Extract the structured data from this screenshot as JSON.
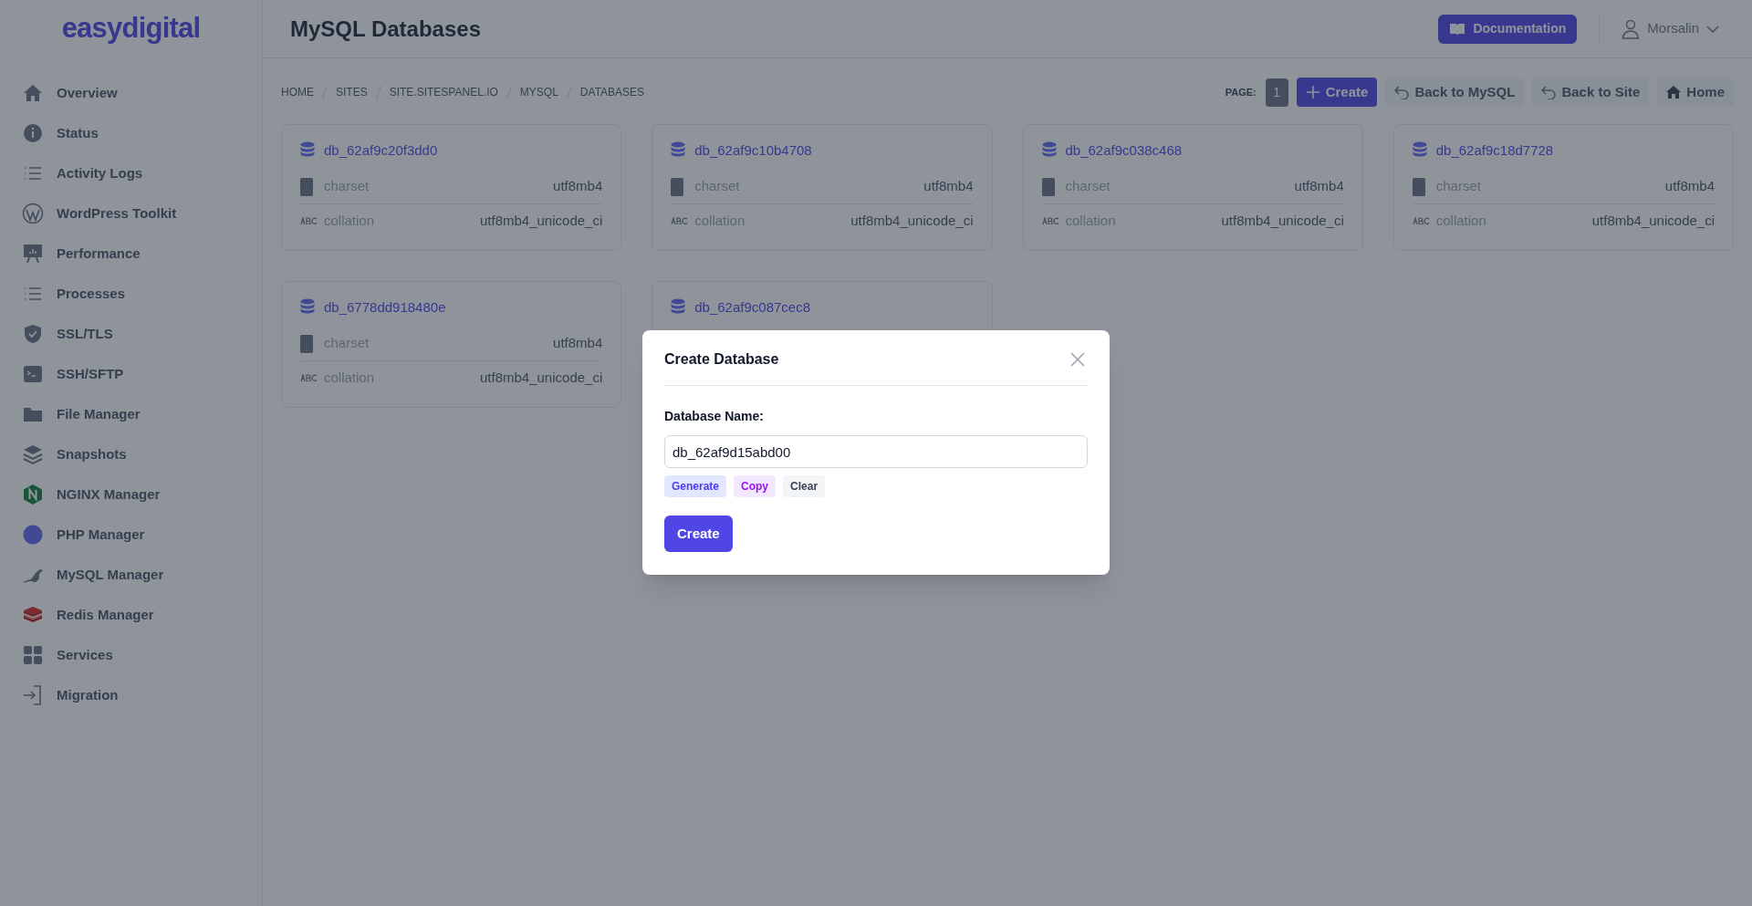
{
  "logo": "easydigital",
  "sidebar": {
    "items": [
      {
        "label": "Overview"
      },
      {
        "label": "Status"
      },
      {
        "label": "Activity Logs"
      },
      {
        "label": "WordPress Toolkit"
      },
      {
        "label": "Performance"
      },
      {
        "label": "Processes"
      },
      {
        "label": "SSL/TLS"
      },
      {
        "label": "SSH/SFTP"
      },
      {
        "label": "File Manager"
      },
      {
        "label": "Snapshots"
      },
      {
        "label": "NGINX Manager"
      },
      {
        "label": "PHP Manager"
      },
      {
        "label": "MySQL Manager"
      },
      {
        "label": "Redis Manager"
      },
      {
        "label": "Services"
      },
      {
        "label": "Migration"
      }
    ]
  },
  "header": {
    "title": "MySQL Databases",
    "documentation": "Documentation",
    "user": "Morsalin"
  },
  "breadcrumb": [
    "HOME",
    "SITES",
    "SITE.SITESPANEL.IO",
    "MYSQL",
    "DATABASES"
  ],
  "toolbar": {
    "page_label": "PAGE:",
    "page": "1",
    "buttons": [
      "Create",
      "Back to MySQL",
      "Back to Site",
      "Home"
    ]
  },
  "databases": [
    {
      "name": "db_62af9c20f3dd0",
      "charset_label": "charset",
      "charset": "utf8mb4",
      "collation_label": "collation",
      "collation": "utf8mb4_unicode_ci"
    },
    {
      "name": "db_62af9c10b4708",
      "charset_label": "charset",
      "charset": "utf8mb4",
      "collation_label": "collation",
      "collation": "utf8mb4_unicode_ci"
    },
    {
      "name": "db_62af9c038c468",
      "charset_label": "charset",
      "charset": "utf8mb4",
      "collation_label": "collation",
      "collation": "utf8mb4_unicode_ci"
    },
    {
      "name": "db_62af9c18d7728",
      "charset_label": "charset",
      "charset": "utf8mb4",
      "collation_label": "collation",
      "collation": "utf8mb4_unicode_ci"
    },
    {
      "name": "db_6778dd918480e",
      "charset_label": "charset",
      "charset": "utf8mb4",
      "collation_label": "collation",
      "collation": "utf8mb4_unicode_ci"
    },
    {
      "name": "db_62af9c087cec8"
    }
  ],
  "modal": {
    "title": "Create Database",
    "field_label": "Database Name:",
    "field_value": "db_62af9d15abd00",
    "actions": [
      "Generate",
      "Copy",
      "Clear"
    ],
    "submit": "Create"
  }
}
